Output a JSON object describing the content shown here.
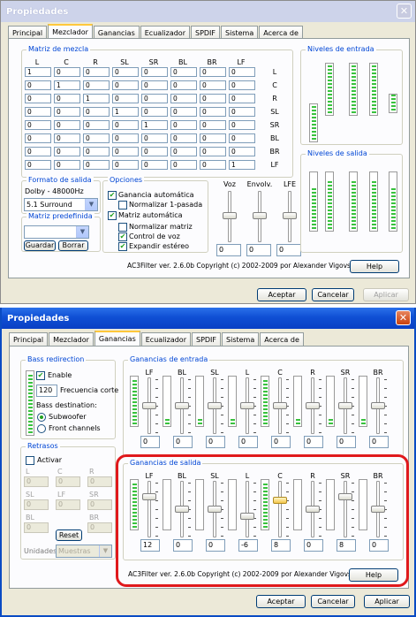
{
  "windows": [
    {
      "title": "Propiedades",
      "tabs": [
        "Principal",
        "Mezclador",
        "Ganancias",
        "Ecualizador",
        "SPDIF",
        "Sistema",
        "Acerca de"
      ],
      "active_tab": 1,
      "matrix": {
        "group_title": "Matriz de mezcla",
        "col_headers": [
          "L",
          "C",
          "R",
          "SL",
          "SR",
          "BL",
          "BR",
          "LF"
        ],
        "row_labels": [
          "L",
          "C",
          "R",
          "SL",
          "SR",
          "BL",
          "BR",
          "LF"
        ],
        "rows": [
          [
            "1",
            "0",
            "0",
            "0",
            "0",
            "0",
            "0",
            "0"
          ],
          [
            "0",
            "1",
            "0",
            "0",
            "0",
            "0",
            "0",
            "0"
          ],
          [
            "0",
            "0",
            "1",
            "0",
            "0",
            "0",
            "0",
            "0"
          ],
          [
            "0",
            "0",
            "0",
            "1",
            "0",
            "0",
            "0",
            "0"
          ],
          [
            "0",
            "0",
            "0",
            "0",
            "1",
            "0",
            "0",
            "0"
          ],
          [
            "0",
            "0",
            "0",
            "0",
            "0",
            "0",
            "0",
            "0"
          ],
          [
            "0",
            "0",
            "0",
            "0",
            "0",
            "0",
            "0",
            "0"
          ],
          [
            "0",
            "0",
            "0",
            "0",
            "0",
            "0",
            "0",
            "1"
          ]
        ]
      },
      "output_format": {
        "title": "Formato de salida",
        "rate": "Dolby - 48000Hz",
        "selected": "5.1 Surround"
      },
      "preset": {
        "title": "Matriz predefinida",
        "selected": "",
        "save": "Guardar",
        "delete": "Borrar"
      },
      "options": {
        "title": "Opciones",
        "items": [
          {
            "label": "Ganancia automática",
            "checked": true
          },
          {
            "label": "Normalizar 1-pasada",
            "checked": false
          },
          {
            "label": "Matriz automática",
            "checked": true
          },
          {
            "label": "Normalizar matriz",
            "checked": false
          },
          {
            "label": "Control de voz",
            "checked": true
          },
          {
            "label": "Expandir estéreo",
            "checked": true
          }
        ]
      },
      "sliders": {
        "labels": [
          "Voz",
          "Envolv.",
          "LFE"
        ],
        "values": [
          "0",
          "0",
          "0"
        ]
      },
      "input_levels_title": "Niveles de entrada",
      "output_levels_title": "Niveles de salida",
      "footer": "AC3Filter ver. 2.6.0b Copyright (c) 2002-2009 por Alexander Vigovsky",
      "help": "Help",
      "buttons": {
        "ok": "Aceptar",
        "cancel": "Cancelar",
        "apply": "Aplicar"
      }
    },
    {
      "title": "Propiedades",
      "tabs": [
        "Principal",
        "Mezclador",
        "Ganancias",
        "Ecualizador",
        "SPDIF",
        "Sistema",
        "Acerca de"
      ],
      "active_tab": 2,
      "bass": {
        "title": "Bass redirection",
        "enable": "Enable",
        "enabled": true,
        "freq_value": "120",
        "freq_label": "Frecuencia corte",
        "dest_label": "Bass destination:",
        "dest_options": [
          "Subwoofer",
          "Front channels"
        ],
        "dest_selected": 0
      },
      "delays": {
        "title": "Retrasos",
        "activate": "Activar",
        "labels_row1": [
          "L",
          "C",
          "R"
        ],
        "labels_row2": [
          "SL",
          "LF",
          "SR"
        ],
        "labels_row3": [
          "BL",
          "BR"
        ],
        "values": [
          "0",
          "0",
          "0",
          "0",
          "0",
          "0",
          "0",
          "0"
        ],
        "reset": "Reset",
        "units_label": "Unidades:",
        "units_value": "Muestras"
      },
      "input_gains": {
        "title": "Ganancias de entrada",
        "channels": [
          "LF",
          "BL",
          "SL",
          "L",
          "C",
          "R",
          "SR",
          "BR"
        ],
        "values": [
          "0",
          "0",
          "0",
          "0",
          "0",
          "0",
          "0",
          "0"
        ]
      },
      "output_gains": {
        "title": "Ganancias de salida",
        "channels": [
          "LF",
          "BL",
          "SL",
          "L",
          "C",
          "R",
          "SR",
          "BR"
        ],
        "values": [
          "12",
          "0",
          "0",
          "-6",
          "8",
          "0",
          "8",
          "0"
        ]
      },
      "footer": "AC3Filter ver. 2.6.0b Copyright (c) 2002-2009 por Alexander Vigovsky",
      "help": "Help",
      "buttons": {
        "ok": "Aceptar",
        "cancel": "Cancelar",
        "apply": "Aplicar"
      }
    }
  ]
}
